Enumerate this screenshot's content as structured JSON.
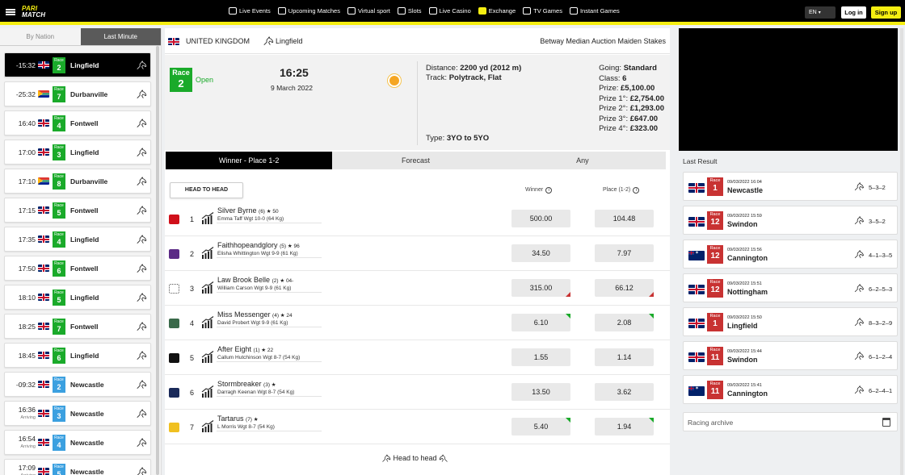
{
  "header": {
    "logo_top": "PARI",
    "logo_bottom": "MATCH",
    "nav": [
      {
        "label": "Live Events",
        "icon": "live-icon"
      },
      {
        "label": "Upcoming Matches",
        "icon": "calendar-icon"
      },
      {
        "label": "Virtual sport",
        "icon": "virtual-icon"
      },
      {
        "label": "Slots",
        "icon": "slots-icon"
      },
      {
        "label": "Live Casino",
        "icon": "casino-icon"
      },
      {
        "label": "Exchange",
        "icon": "exchange-icon"
      },
      {
        "label": "TV Games",
        "icon": "tv-icon"
      },
      {
        "label": "Instant Games",
        "icon": "plane-icon"
      }
    ],
    "lang": "EN",
    "login": "Log in",
    "signup": "Sign up"
  },
  "sidebar": {
    "tabs": [
      "By Nation",
      "Last Minute"
    ],
    "active_tab": 1,
    "races": [
      {
        "time": "-15:32",
        "flag": "uk",
        "race_label": "Race",
        "race": "2",
        "color": "green",
        "venue": "Lingfield",
        "arriving": ""
      },
      {
        "time": "-25:32",
        "flag": "za",
        "race_label": "Race",
        "race": "7",
        "color": "green",
        "venue": "Durbanville",
        "arriving": ""
      },
      {
        "time": "16:40",
        "flag": "uk",
        "race_label": "Race",
        "race": "4",
        "color": "green",
        "venue": "Fontwell",
        "arriving": ""
      },
      {
        "time": "17:00",
        "flag": "uk",
        "race_label": "Race",
        "race": "3",
        "color": "green",
        "venue": "Lingfield",
        "arriving": ""
      },
      {
        "time": "17:10",
        "flag": "za",
        "race_label": "Race",
        "race": "8",
        "color": "green",
        "venue": "Durbanville",
        "arriving": ""
      },
      {
        "time": "17:15",
        "flag": "uk",
        "race_label": "Race",
        "race": "5",
        "color": "green",
        "venue": "Fontwell",
        "arriving": ""
      },
      {
        "time": "17:35",
        "flag": "uk",
        "race_label": "Race",
        "race": "4",
        "color": "green",
        "venue": "Lingfield",
        "arriving": ""
      },
      {
        "time": "17:50",
        "flag": "uk",
        "race_label": "Race",
        "race": "6",
        "color": "green",
        "venue": "Fontwell",
        "arriving": ""
      },
      {
        "time": "18:10",
        "flag": "uk",
        "race_label": "Race",
        "race": "5",
        "color": "green",
        "venue": "Lingfield",
        "arriving": ""
      },
      {
        "time": "18:25",
        "flag": "uk",
        "race_label": "Race",
        "race": "7",
        "color": "green",
        "venue": "Fontwell",
        "arriving": ""
      },
      {
        "time": "18:45",
        "flag": "uk",
        "race_label": "Race",
        "race": "6",
        "color": "green",
        "venue": "Lingfield",
        "arriving": ""
      },
      {
        "time": "-09:32",
        "flag": "uk",
        "race_label": "Race",
        "race": "2",
        "color": "blue",
        "venue": "Newcastle",
        "arriving": ""
      },
      {
        "time": "16:36",
        "flag": "uk",
        "race_label": "Race",
        "race": "3",
        "color": "blue",
        "venue": "Newcastle",
        "arriving": "Arriving"
      },
      {
        "time": "16:54",
        "flag": "uk",
        "race_label": "Race",
        "race": "4",
        "color": "blue",
        "venue": "Newcastle",
        "arriving": "Arriving"
      },
      {
        "time": "17:09",
        "flag": "uk",
        "race_label": "Race",
        "race": "5",
        "color": "blue",
        "venue": "Newcastle",
        "arriving": "Arriving"
      }
    ]
  },
  "race": {
    "country": "UNITED KINGDOM",
    "track": "Lingfield",
    "stakes": "Betway Median Auction Maiden Stakes",
    "race_label": "Race",
    "race_number": "2",
    "status": "Open",
    "time": "16:25",
    "date": "9 March 2022",
    "distance_label": "Distance:",
    "distance": "2200 yd (2012 m)",
    "track_label": "Track:",
    "track_type": "Polytrack, Flat",
    "type_label": "Type:",
    "type": "3YO to 5YO",
    "going_label": "Going:",
    "going": "Standard",
    "class_label": "Class:",
    "class": "6",
    "prize_label": "Prize:",
    "prize": "£5,100.00",
    "prize1_label": "Prize 1°:",
    "prize1": "£2,754.00",
    "prize2_label": "Prize 2°:",
    "prize2": "£1,293.00",
    "prize3_label": "Prize 3°:",
    "prize3": "£647.00",
    "prize4_label": "Prize 4°:",
    "prize4": "£323.00"
  },
  "bet_tabs": [
    "Winner - Place 1-2",
    "Forecast",
    "Any"
  ],
  "head_to_head_button": "HEAD TO HEAD",
  "columns": {
    "winner": "Winner",
    "place": "Place (1-2)"
  },
  "runners": [
    {
      "num": "1",
      "name": "Silver Byrne",
      "meta": "(6) ★ 50",
      "jockey": "Emma Taff Wgt 10-0 (64 Kg)",
      "winner": "500.00",
      "place": "104.48",
      "w_trend": "",
      "p_trend": "",
      "silk": "#d0101a"
    },
    {
      "num": "2",
      "name": "Faithhopeandglory",
      "meta": "(5) ★ 96",
      "jockey": "Elisha Whittington Wgt 9-9 (61 Kg)",
      "winner": "34.50",
      "place": "7.97",
      "w_trend": "",
      "p_trend": "",
      "silk": "#5b2a86"
    },
    {
      "num": "3",
      "name": "Law Brook Belle",
      "meta": "(2) ★ 04-",
      "jockey": "William Carson Wgt 9-9 (61 Kg)",
      "winner": "315.00",
      "place": "66.12",
      "w_trend": "down",
      "p_trend": "down",
      "silk": "#ffffff"
    },
    {
      "num": "4",
      "name": "Miss Messenger",
      "meta": "(4) ★ 24",
      "jockey": "David Probert Wgt 9-9 (61 Kg)",
      "winner": "6.10",
      "place": "2.08",
      "w_trend": "up",
      "p_trend": "up",
      "silk": "#3a6a4a"
    },
    {
      "num": "5",
      "name": "After Eight",
      "meta": "(1) ★ 22",
      "jockey": "Callum Hutchinson Wgt 8-7 (54 Kg)",
      "winner": "1.55",
      "place": "1.14",
      "w_trend": "",
      "p_trend": "",
      "silk": "#111111"
    },
    {
      "num": "6",
      "name": "Stormbreaker",
      "meta": "(3) ★",
      "jockey": "Darragh Keenan Wgt 8-7 (54 Kg)",
      "winner": "13.50",
      "place": "3.62",
      "w_trend": "",
      "p_trend": "",
      "silk": "#1a2a5a"
    },
    {
      "num": "7",
      "name": "Tartarus",
      "meta": "(7) ★",
      "jockey": "L Morris Wgt 8-7 (54 Kg)",
      "winner": "5.40",
      "place": "1.94",
      "w_trend": "up",
      "p_trend": "up",
      "silk": "#f0c020"
    }
  ],
  "h2h_link": "Head to head",
  "last_result": {
    "title": "Last Result",
    "items": [
      {
        "flag": "uk",
        "race_label": "Race",
        "race": "1",
        "datetime": "09/03/2022 16:04",
        "venue": "Newcastle",
        "positions": "5–3–2"
      },
      {
        "flag": "uk",
        "race_label": "Race",
        "race": "12",
        "datetime": "09/03/2022 15:59",
        "venue": "Swindon",
        "positions": "3–5–2"
      },
      {
        "flag": "au",
        "race_label": "Race",
        "race": "12",
        "datetime": "09/03/2022 15:56",
        "venue": "Cannington",
        "positions": "4–1–3–5"
      },
      {
        "flag": "uk",
        "race_label": "Race",
        "race": "12",
        "datetime": "09/03/2022 15:51",
        "venue": "Nottingham",
        "positions": "6–2–5–3"
      },
      {
        "flag": "uk",
        "race_label": "Race",
        "race": "1",
        "datetime": "09/03/2022 15:50",
        "venue": "Lingfield",
        "positions": "8–3–2–9"
      },
      {
        "flag": "uk",
        "race_label": "Race",
        "race": "11",
        "datetime": "09/03/2022 15:44",
        "venue": "Swindon",
        "positions": "6–1–2–4"
      },
      {
        "flag": "au",
        "race_label": "Race",
        "race": "11",
        "datetime": "09/03/2022 15:41",
        "venue": "Cannington",
        "positions": "6–2–4–1"
      }
    ]
  },
  "archive_placeholder": "Racing archive",
  "colors": {
    "accent": "#f5ee11",
    "race_green": "#1aaa2a",
    "race_blue": "#3ba0e0",
    "race_red": "#c83232"
  }
}
